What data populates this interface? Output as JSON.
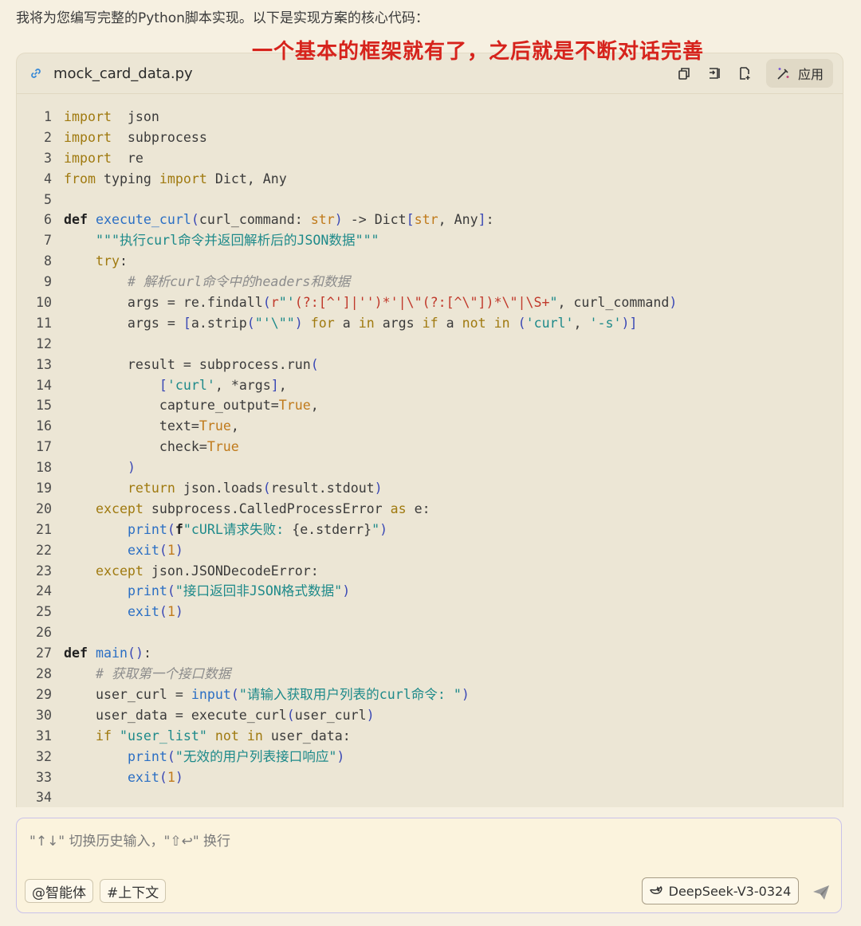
{
  "intro_text": "我将为您编写完整的Python脚本实现。以下是实现方案的核心代码：",
  "annotation": "一个基本的框架就有了，之后就是不断对话完善",
  "code_card": {
    "file_name": "mock_card_data.py",
    "file_icon": "link-icon",
    "actions": [
      {
        "name": "copy-icon"
      },
      {
        "name": "insert-icon"
      },
      {
        "name": "new-file-icon"
      }
    ],
    "apply_label": "应用",
    "apply_icon": "magic-wand-icon",
    "lines": [
      [
        [
          "kw",
          "import"
        ],
        [
          "",
          "  json"
        ]
      ],
      [
        [
          "kw",
          "import"
        ],
        [
          "",
          "  subprocess"
        ]
      ],
      [
        [
          "kw",
          "import"
        ],
        [
          "",
          "  re"
        ]
      ],
      [
        [
          "kw",
          "from"
        ],
        [
          "",
          " typing "
        ],
        [
          "kw",
          "import"
        ],
        [
          "",
          " Dict, Any"
        ]
      ],
      [],
      [
        [
          "kb",
          "def"
        ],
        [
          "",
          " "
        ],
        [
          "fn",
          "execute_curl"
        ],
        [
          "pn",
          "("
        ],
        [
          "",
          "curl_command: "
        ],
        [
          "bi",
          "str"
        ],
        [
          "pn",
          ")"
        ],
        [
          "",
          " -> Dict"
        ],
        [
          "pn",
          "["
        ],
        [
          "bi",
          "str"
        ],
        [
          "",
          ", Any"
        ],
        [
          "pn",
          "]"
        ],
        [
          "",
          ":"
        ]
      ],
      [
        [
          "",
          "    "
        ],
        [
          "st",
          "\"\"\"执行curl命令并返回解析后的JSON数据\"\"\""
        ]
      ],
      [
        [
          "",
          "    "
        ],
        [
          "kw",
          "try"
        ],
        [
          "",
          ":"
        ]
      ],
      [
        [
          "",
          "        "
        ],
        [
          "cm",
          "# 解析curl命令中的headers和数据"
        ]
      ],
      [
        [
          "",
          "        args = re.findall"
        ],
        [
          "pn",
          "("
        ],
        [
          "er",
          "r"
        ],
        [
          "st",
          "\"'"
        ],
        [
          "er",
          "(?:[^']|'')*'|\\\"(?:[^\\\"])*\\\"|\\S+"
        ],
        [
          "st",
          "\""
        ],
        [
          "",
          ", curl_command"
        ],
        [
          "pn",
          ")"
        ]
      ],
      [
        [
          "",
          "        args = "
        ],
        [
          "pn",
          "["
        ],
        [
          "",
          "a.strip"
        ],
        [
          "pn",
          "("
        ],
        [
          "st",
          "\"'\\\"\""
        ],
        [
          "pn",
          ")"
        ],
        [
          "",
          " "
        ],
        [
          "kw",
          "for"
        ],
        [
          "",
          " a "
        ],
        [
          "kw",
          "in"
        ],
        [
          "",
          " args "
        ],
        [
          "kw",
          "if"
        ],
        [
          "",
          " a "
        ],
        [
          "kw",
          "not"
        ],
        [
          "",
          " "
        ],
        [
          "kw",
          "in"
        ],
        [
          "",
          " "
        ],
        [
          "pn",
          "("
        ],
        [
          "st",
          "'curl'"
        ],
        [
          "",
          ", "
        ],
        [
          "st",
          "'-s'"
        ],
        [
          "pn",
          ")]"
        ]
      ],
      [],
      [
        [
          "",
          "        result = subprocess.run"
        ],
        [
          "pn",
          "("
        ]
      ],
      [
        [
          "",
          "            "
        ],
        [
          "pn",
          "["
        ],
        [
          "st",
          "'curl'"
        ],
        [
          "",
          ", *args"
        ],
        [
          "pn",
          "]"
        ],
        [
          "",
          ","
        ]
      ],
      [
        [
          "",
          "            capture_output="
        ],
        [
          "bi",
          "True"
        ],
        [
          "",
          ","
        ]
      ],
      [
        [
          "",
          "            text="
        ],
        [
          "bi",
          "True"
        ],
        [
          "",
          ","
        ]
      ],
      [
        [
          "",
          "            check="
        ],
        [
          "bi",
          "True"
        ]
      ],
      [
        [
          "",
          "        "
        ],
        [
          "pn",
          ")"
        ]
      ],
      [
        [
          "",
          "        "
        ],
        [
          "kw",
          "return"
        ],
        [
          "",
          " json.loads"
        ],
        [
          "pn",
          "("
        ],
        [
          "",
          "result.stdout"
        ],
        [
          "pn",
          ")"
        ]
      ],
      [
        [
          "",
          "    "
        ],
        [
          "kw",
          "except"
        ],
        [
          "",
          " subprocess.CalledProcessError "
        ],
        [
          "kw",
          "as"
        ],
        [
          "",
          " e:"
        ]
      ],
      [
        [
          "",
          "        "
        ],
        [
          "fn",
          "print"
        ],
        [
          "pn",
          "("
        ],
        [
          "kb",
          "f"
        ],
        [
          "st",
          "\"cURL请求失败: "
        ],
        [
          "",
          "{e.stderr}"
        ],
        [
          "st",
          "\""
        ],
        [
          "pn",
          ")"
        ]
      ],
      [
        [
          "",
          "        "
        ],
        [
          "fn",
          "exit"
        ],
        [
          "pn",
          "("
        ],
        [
          "bi",
          "1"
        ],
        [
          "pn",
          ")"
        ]
      ],
      [
        [
          "",
          "    "
        ],
        [
          "kw",
          "except"
        ],
        [
          "",
          " json.JSONDecodeError:"
        ]
      ],
      [
        [
          "",
          "        "
        ],
        [
          "fn",
          "print"
        ],
        [
          "pn",
          "("
        ],
        [
          "st",
          "\"接口返回非JSON格式数据\""
        ],
        [
          "pn",
          ")"
        ]
      ],
      [
        [
          "",
          "        "
        ],
        [
          "fn",
          "exit"
        ],
        [
          "pn",
          "("
        ],
        [
          "bi",
          "1"
        ],
        [
          "pn",
          ")"
        ]
      ],
      [],
      [
        [
          "kb",
          "def"
        ],
        [
          "",
          " "
        ],
        [
          "fn",
          "main"
        ],
        [
          "pn",
          "()"
        ],
        [
          "",
          ":"
        ]
      ],
      [
        [
          "",
          "    "
        ],
        [
          "cm",
          "# 获取第一个接口数据"
        ]
      ],
      [
        [
          "",
          "    user_curl = "
        ],
        [
          "fn",
          "input"
        ],
        [
          "pn",
          "("
        ],
        [
          "st",
          "\"请输入获取用户列表的curl命令: \""
        ],
        [
          "pn",
          ")"
        ]
      ],
      [
        [
          "",
          "    user_data = execute_curl"
        ],
        [
          "pn",
          "("
        ],
        [
          "",
          "user_curl"
        ],
        [
          "pn",
          ")"
        ]
      ],
      [
        [
          "",
          "    "
        ],
        [
          "kw",
          "if"
        ],
        [
          "",
          " "
        ],
        [
          "st",
          "\"user_list\""
        ],
        [
          "",
          " "
        ],
        [
          "kw",
          "not"
        ],
        [
          "",
          " "
        ],
        [
          "kw",
          "in"
        ],
        [
          "",
          " user_data:"
        ]
      ],
      [
        [
          "",
          "        "
        ],
        [
          "fn",
          "print"
        ],
        [
          "pn",
          "("
        ],
        [
          "st",
          "\"无效的用户列表接口响应\""
        ],
        [
          "pn",
          ")"
        ]
      ],
      [
        [
          "",
          "        "
        ],
        [
          "fn",
          "exit"
        ],
        [
          "pn",
          "("
        ],
        [
          "bi",
          "1"
        ],
        [
          "pn",
          ")"
        ]
      ],
      []
    ]
  },
  "chat_input": {
    "placeholder": "\"↑↓\" 切换历史输入，\"⇧↩\" 换行",
    "value": "",
    "agent_chip": "@智能体",
    "context_chip": "#上下文",
    "model_label": "DeepSeek-V3-0324",
    "model_icon": "whale-icon",
    "send_icon": "send-icon"
  }
}
